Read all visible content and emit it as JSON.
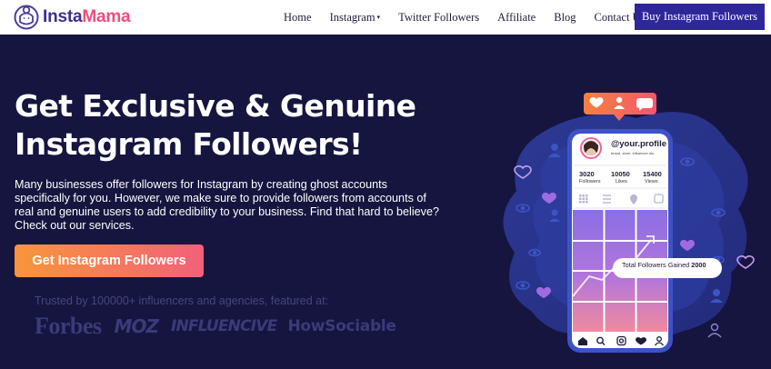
{
  "nav": {
    "logo_part1": "Insta",
    "logo_part2": "Mama",
    "links": [
      {
        "label": "Home"
      },
      {
        "label": "Instagram",
        "caret": "▾"
      },
      {
        "label": "Twitter Followers"
      },
      {
        "label": "Affiliate"
      },
      {
        "label": "Blog"
      },
      {
        "label": "Contact Us"
      }
    ],
    "buy_button": "Buy Instagram Followers"
  },
  "hero": {
    "title_line1": "Get Exclusive & Genuine",
    "title_line2": "Instagram Followers!",
    "description": "Many businesses offer followers for Instagram by creating ghost accounts specifically for you. However, we make sure to provide followers from accounts of real and genuine users to add credibility to your business. Find that hard to believe? Check out our services.",
    "cta_label": "Get Instagram Followers",
    "trusted_text": "Trusted by 100000+ influencers and agencies, featured at:",
    "brands": [
      "Forbes",
      "MOZ",
      "INFLUENCIVE",
      "HowSociable"
    ]
  },
  "profile": {
    "handle": "@your.profile",
    "bio": "brand, store, influencer etc.",
    "stats": [
      {
        "value": "3020",
        "label": "Followers"
      },
      {
        "value": "10050",
        "label": "Likes"
      },
      {
        "value": "15400",
        "label": "Views"
      }
    ],
    "gained_label": "Total Followers Gained",
    "gained_value": "2000"
  },
  "colors": {
    "navy": "#16153f",
    "brand_purple": "#2d279a",
    "brand_pink": "#ef4d7f",
    "cta_start": "#f7963a",
    "cta_end": "#f2607a",
    "bubble_orange": "#f76a5e"
  },
  "icons": [
    "logo-mom-icon",
    "heart-icon",
    "person-icon",
    "chat-icon",
    "eye-icon",
    "grid-icon",
    "list-icon",
    "pin-icon",
    "tag-icon",
    "home-icon",
    "search-icon",
    "instagram-icon",
    "user-icon"
  ]
}
